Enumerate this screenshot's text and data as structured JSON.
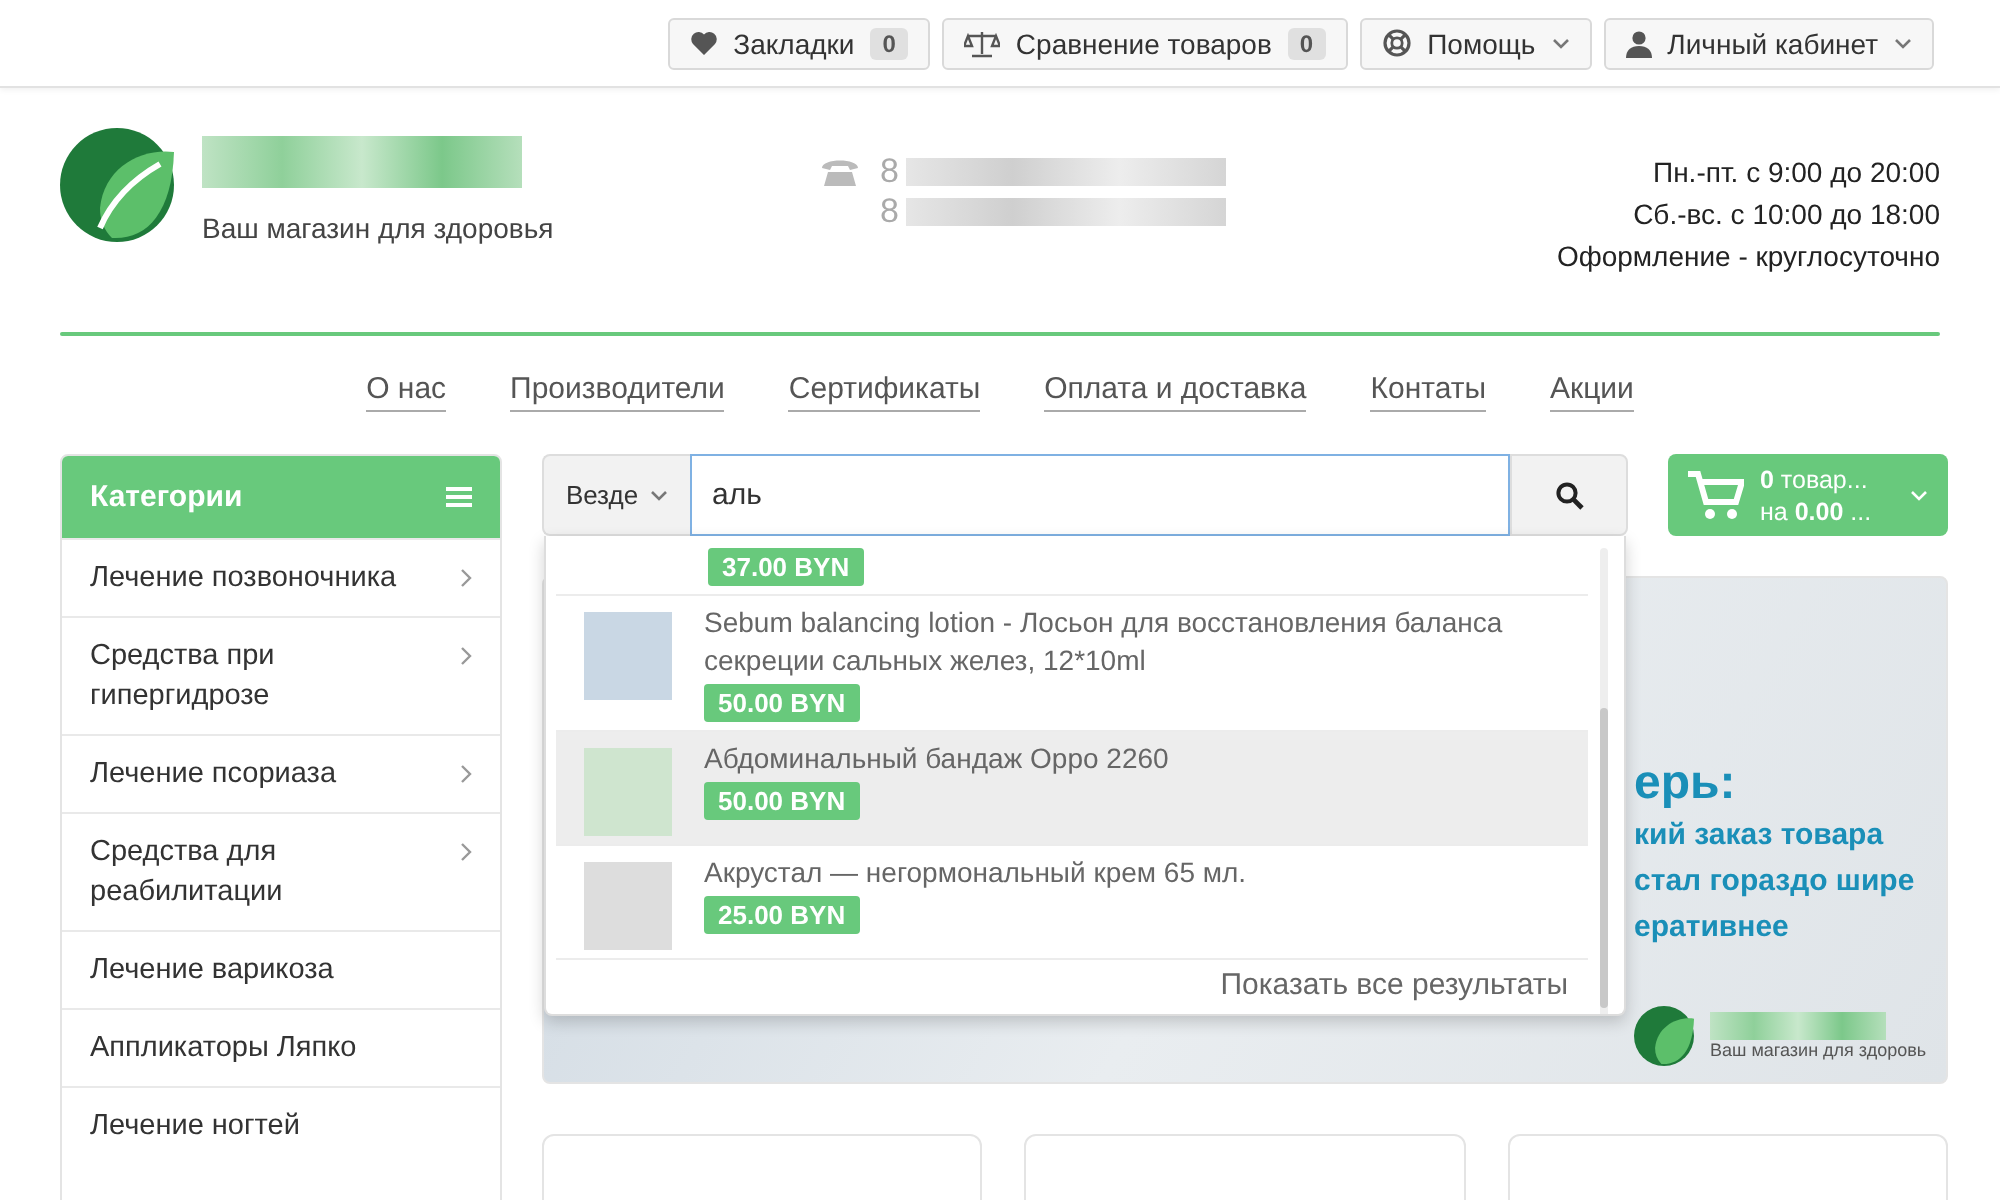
{
  "top_bar": {
    "buttons": [
      {
        "label": "Закладки",
        "count": "0",
        "dropdown": false
      },
      {
        "label": "Сравнение товаров",
        "count": "0",
        "dropdown": false
      },
      {
        "label": "Помощь",
        "dropdown": true
      },
      {
        "label": "Личный кабинет",
        "dropdown": true
      }
    ]
  },
  "header": {
    "tagline": "Ваш магазин для здоровья",
    "phones": [
      "8",
      "8"
    ],
    "hours": [
      "Пн.-пт. с 9:00 до 20:00",
      "Сб.-вс. с 10:00 до 18:00",
      "Оформление - круглосуточно"
    ]
  },
  "nav": [
    "О нас",
    "Производители",
    "Сертификаты",
    "Оплата и доставка",
    "Контаты",
    "Акции"
  ],
  "categories": {
    "title": "Категории",
    "items": [
      {
        "label": "Лечение позвоночника",
        "has_submenu": true
      },
      {
        "label": "Средства при гипергидрозе",
        "has_submenu": true
      },
      {
        "label": "Лечение псориаза",
        "has_submenu": true
      },
      {
        "label": "Средства для реабилитации",
        "has_submenu": true
      },
      {
        "label": "Лечение варикоза",
        "has_submenu": false
      },
      {
        "label": "Аппликаторы Ляпко",
        "has_submenu": false
      },
      {
        "label": "Лечение ногтей",
        "has_submenu": false
      }
    ]
  },
  "search": {
    "scope": "Везде",
    "value": "аль"
  },
  "cart": {
    "count_line": "**0** товар...",
    "sum_line": "на **0.00** ..."
  },
  "results": {
    "items": [
      {
        "price": "37.00 BYN",
        "selected": false,
        "cut": true
      },
      {
        "title": "Sebum balancing lotion - Лосьон для восстановления баланса секреции сальных желез, 12*10ml",
        "price": "50.00 BYN",
        "selected": false,
        "cut": false
      },
      {
        "title": "Абдоминальный бандаж Oppo 2260",
        "price": "50.00 BYN",
        "selected": true,
        "cut": false
      },
      {
        "title": "Акрустал — негормональный крем 65 мл.",
        "price": "25.00 BYN",
        "selected": false,
        "cut": false
      }
    ],
    "show_all": "Показать все результаты"
  },
  "banner": {
    "heading": "ерь:",
    "lines": [
      "кий заказ товара",
      "стал гораздо шире",
      "еративнее"
    ],
    "tagline": "Ваш магазин для здоровь"
  }
}
